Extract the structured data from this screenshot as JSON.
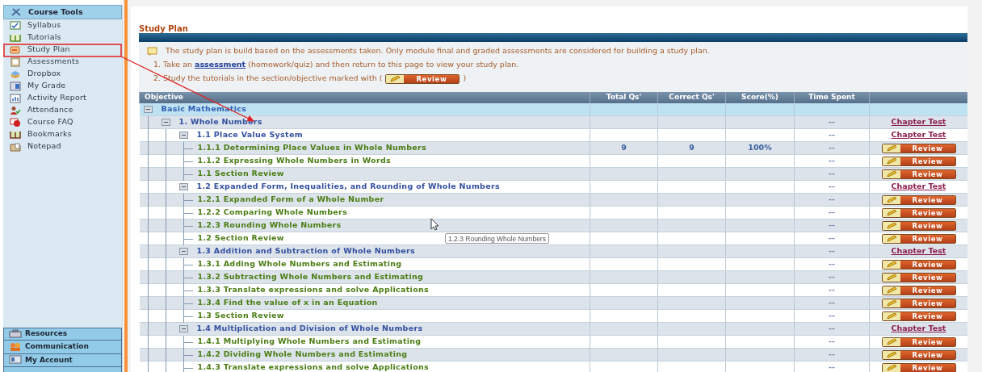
{
  "sidebar": {
    "title": "Course Tools",
    "items": [
      "Syllabus",
      "Tutorials",
      "Study Plan",
      "Assessments",
      "Dropbox",
      "My Grade",
      "Activity Report",
      "Attendance",
      "Course FAQ",
      "Bookmarks",
      "Notepad"
    ],
    "bottom_items": [
      "Resources",
      "Communication",
      "My Account"
    ]
  },
  "page_title": "Study Plan",
  "info": {
    "note": "The study plan is build based on the assessments taken. Only module final and graded assessments are considered for building a study plan.",
    "step1": {
      "prefix": "1. Take an ",
      "link": "assessment",
      "suffix": " (homework/quiz) and then return to this page to view your study plan."
    },
    "step2": {
      "prefix": "2. Study the tutorials in the section/objective marked with (",
      "button": "Review",
      "suffix": ")"
    }
  },
  "table": {
    "columns": [
      "Objective",
      "Total Qs'",
      "Correct Qs'",
      "Score(%)",
      "Time Spent"
    ],
    "rows": [
      {
        "label": "Basic Mathematics",
        "kind": "subject",
        "expanded": true,
        "children": [
          {
            "label": "1. Whole Numbers",
            "kind": "chapter",
            "expanded": true,
            "time": "--",
            "action": {
              "kind": "link",
              "label": "Chapter Test"
            },
            "children": [
              {
                "label": "1.1 Place Value System",
                "kind": "section",
                "expanded": true,
                "time": "--",
                "action": {
                  "kind": "link",
                  "label": "Chapter Test"
                },
                "children": [
                  {
                    "label": "1.1.1 Determining Place Values in Whole Numbers",
                    "kind": "objective",
                    "total": "9",
                    "correct": "9",
                    "score": "100%",
                    "time": "--",
                    "action": {
                      "kind": "button",
                      "label": "Review"
                    }
                  },
                  {
                    "label": "1.1.2 Expressing Whole Numbers in Words",
                    "kind": "objective",
                    "time": "--",
                    "action": {
                      "kind": "button",
                      "label": "Review"
                    }
                  },
                  {
                    "label": "1.1 Section Review",
                    "kind": "objective",
                    "time": "--",
                    "action": {
                      "kind": "button",
                      "label": "Review"
                    }
                  }
                ]
              },
              {
                "label": "1.2 Expanded Form, Inequalities, and Rounding of Whole Numbers",
                "kind": "section",
                "expanded": true,
                "time": "--",
                "action": {
                  "kind": "link",
                  "label": "Chapter Test"
                },
                "children": [
                  {
                    "label": "1.2.1 Expanded Form of a Whole Number",
                    "kind": "objective",
                    "time": "--",
                    "action": {
                      "kind": "button",
                      "label": "Review"
                    }
                  },
                  {
                    "label": "1.2.2 Comparing Whole Numbers",
                    "kind": "objective",
                    "time": "--",
                    "action": {
                      "kind": "button",
                      "label": "Review"
                    }
                  },
                  {
                    "label": "1.2.3 Rounding Whole Numbers",
                    "kind": "objective",
                    "time": "--",
                    "action": {
                      "kind": "button",
                      "label": "Review"
                    }
                  },
                  {
                    "label": "1.2 Section Review",
                    "kind": "objective",
                    "time": "--",
                    "action": {
                      "kind": "button",
                      "label": "Review"
                    }
                  }
                ]
              },
              {
                "label": "1.3 Addition and Subtraction of Whole Numbers",
                "kind": "section",
                "expanded": true,
                "time": "--",
                "action": {
                  "kind": "link",
                  "label": "Chapter Test"
                },
                "children": [
                  {
                    "label": "1.3.1 Adding Whole Numbers and Estimating",
                    "kind": "objective",
                    "time": "--",
                    "action": {
                      "kind": "button",
                      "label": "Review"
                    }
                  },
                  {
                    "label": "1.3.2 Subtracting Whole Numbers and Estimating",
                    "kind": "objective",
                    "time": "--",
                    "action": {
                      "kind": "button",
                      "label": "Review"
                    }
                  },
                  {
                    "label": "1.3.3 Translate expressions and solve Applications",
                    "kind": "objective",
                    "time": "--",
                    "action": {
                      "kind": "button",
                      "label": "Review"
                    }
                  },
                  {
                    "label": "1.3.4 Find the value of x in an Equation",
                    "kind": "objective",
                    "time": "--",
                    "action": {
                      "kind": "button",
                      "label": "Review"
                    }
                  },
                  {
                    "label": "1.3 Section Review",
                    "kind": "objective",
                    "time": "--",
                    "action": {
                      "kind": "button",
                      "label": "Review"
                    }
                  }
                ]
              },
              {
                "label": "1.4 Multiplication and Division of Whole Numbers",
                "kind": "section",
                "expanded": true,
                "time": "--",
                "action": {
                  "kind": "link",
                  "label": "Chapter Test"
                },
                "children": [
                  {
                    "label": "1.4.1 Multiplying Whole Numbers and Estimating",
                    "kind": "objective",
                    "time": "--",
                    "action": {
                      "kind": "button",
                      "label": "Review"
                    }
                  },
                  {
                    "label": "1.4.2 Dividing Whole Numbers and Estimating",
                    "kind": "objective",
                    "time": "--",
                    "action": {
                      "kind": "button",
                      "label": "Review"
                    }
                  },
                  {
                    "label": "1.4.3 Translate expressions and solve Applications",
                    "kind": "objective",
                    "time": "--",
                    "action": {
                      "kind": "button",
                      "label": "Review"
                    }
                  }
                ]
              }
            ]
          }
        ]
      }
    ]
  },
  "tooltip": "1.2.3 Rounding Whole Numbers"
}
